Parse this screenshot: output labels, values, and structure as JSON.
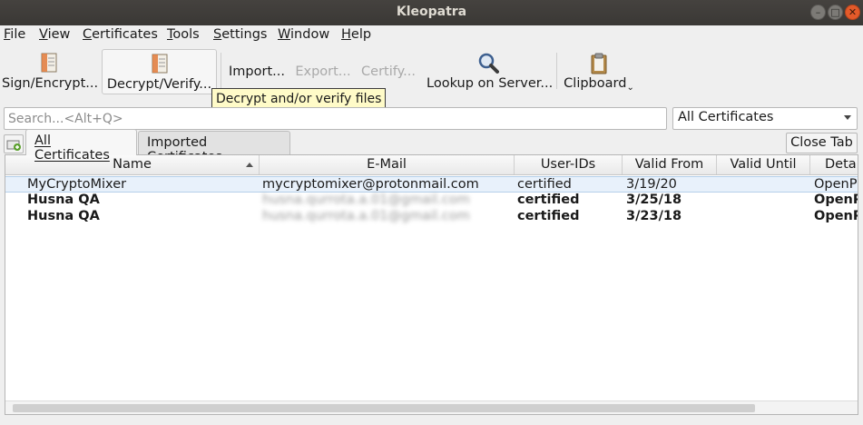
{
  "window": {
    "title": "Kleopatra"
  },
  "menubar": [
    {
      "label": "File",
      "mnemonic": "F",
      "rest": "ile"
    },
    {
      "label": "View",
      "mnemonic": "V",
      "rest": "iew"
    },
    {
      "label": "Certificates",
      "mnemonic": "C",
      "rest": "ertificates"
    },
    {
      "label": "Tools",
      "mnemonic": "T",
      "rest": "ools"
    },
    {
      "label": "Settings",
      "mnemonic": "S",
      "rest": "ettings"
    },
    {
      "label": "Window",
      "mnemonic": "W",
      "rest": "indow"
    },
    {
      "label": "Help",
      "mnemonic": "H",
      "rest": "elp"
    }
  ],
  "toolbar": {
    "sign_encrypt": "Sign/Encrypt...",
    "decrypt_verify": "Decrypt/Verify...",
    "import": "Import...",
    "export": "Export...",
    "certify": "Certify...",
    "lookup": "Lookup on Server...",
    "clipboard": "Clipboard"
  },
  "tooltip": "Decrypt and/or verify files",
  "search": {
    "placeholder": "Search...<Alt+Q>",
    "value": ""
  },
  "filter": {
    "selected": "All Certificates"
  },
  "tabs": [
    {
      "label": "All Certificates",
      "active": true
    },
    {
      "label": "Imported Certificates",
      "active": false
    }
  ],
  "close_tab": "Close Tab",
  "table": {
    "columns": [
      "Name",
      "E-Mail",
      "User-IDs",
      "Valid From",
      "Valid Until",
      "Details"
    ],
    "rows": [
      {
        "name": "MyCryptoMixer",
        "email": "mycryptomixer@protonmail.com",
        "user_ids": "certified",
        "valid_from": "3/19/20",
        "valid_until": "",
        "details": "OpenPGP"
      },
      {
        "name": "Husna QA",
        "email": "husna.qurrota.a.01@gmail.com",
        "user_ids": "certified",
        "valid_from": "3/25/18",
        "valid_until": "",
        "details": "OpenPGP"
      },
      {
        "name": "Husna QA",
        "email": "husna.qurrota.a.01@gmail.com",
        "user_ids": "certified",
        "valid_from": "3/23/18",
        "valid_until": "",
        "details": "OpenPGP"
      }
    ]
  },
  "colors": {
    "titlebar": "#3f3d3a",
    "close_button": "#e35a2a",
    "tooltip_bg": "#fffbc8",
    "selection": "#e8f1fb"
  }
}
